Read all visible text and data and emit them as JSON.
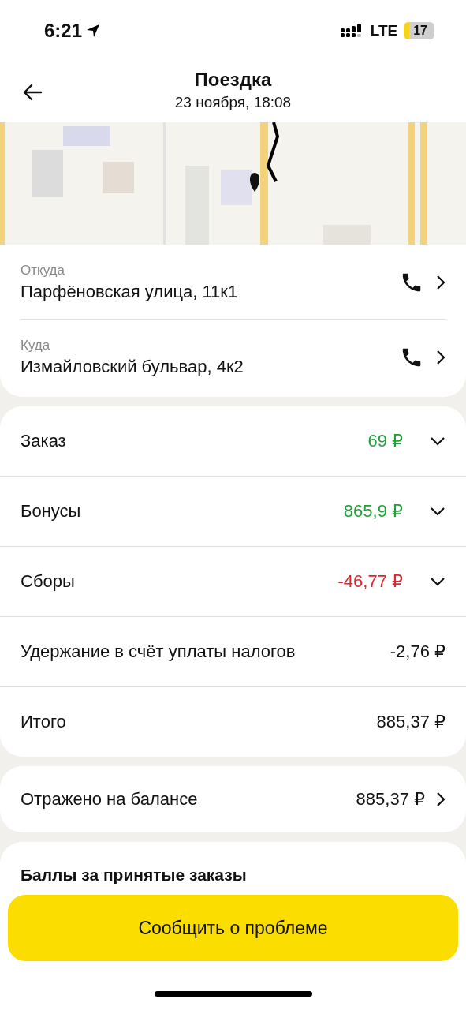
{
  "status_bar": {
    "time": "6:21",
    "network": "LTE",
    "battery": "17"
  },
  "header": {
    "title": "Поездка",
    "subtitle": "23 ноября, 18:08"
  },
  "route": [
    {
      "label": "Откуда",
      "address": "Парфёновская улица, 11к1"
    },
    {
      "label": "Куда",
      "address": "Измайловский бульвар, 4к2"
    }
  ],
  "payment": [
    {
      "kind": "expandable",
      "label": "Заказ",
      "amount": "69 ₽",
      "color": "#21a038",
      "expanded": false
    },
    {
      "kind": "expandable",
      "label": "Бонусы",
      "amount": "865,9 ₽",
      "color": "#21a038",
      "expanded": false
    },
    {
      "kind": "expandable",
      "label": "Сборы",
      "amount": "-46,77 ₽",
      "color": "#e0242c",
      "expanded": false
    },
    {
      "kind": "plain",
      "label": "Удержание в счёт уплаты налогов",
      "amount": "-2,76 ₽"
    },
    {
      "kind": "plain",
      "label": "Итого",
      "amount": "885,37 ₽"
    }
  ],
  "balance": {
    "label": "Отражено на балансе",
    "amount": "885,37 ₽"
  },
  "points": {
    "title": "Баллы за принятые заказы"
  },
  "report_button": "Сообщить о проблеме"
}
